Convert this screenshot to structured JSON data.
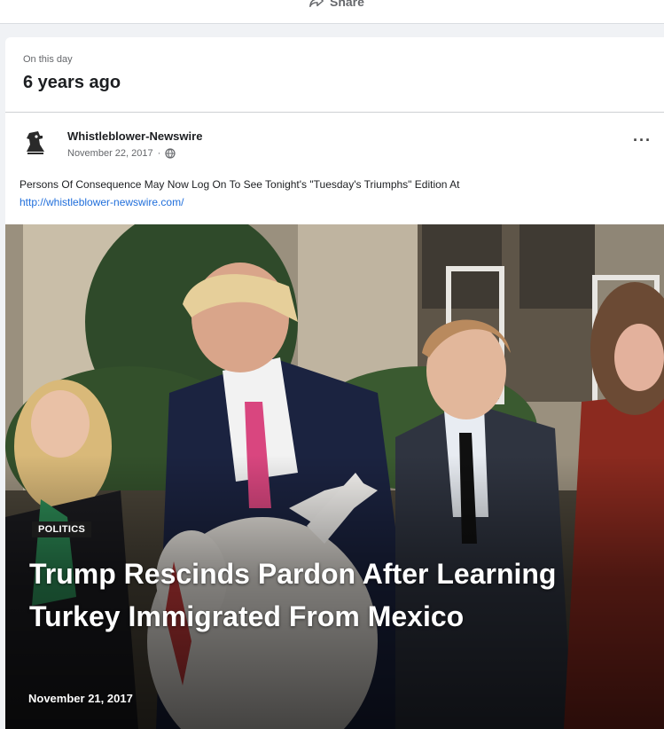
{
  "top_card": {
    "share_label": "Share",
    "share_icon": "share-arrow-icon"
  },
  "memory": {
    "on_this_day": "On this day",
    "years_ago": "6 years ago"
  },
  "post": {
    "page_name": "Whistleblower-Newswire",
    "date": "November 22, 2017",
    "separator": "·",
    "audience_icon": "globe-icon",
    "more_icon": "more-options-icon",
    "more_label": "···",
    "text": "Persons Of Consequence May Now Log On To See Tonight's \"Tuesday's Triumphs\" Edition At",
    "link": "http://whistleblower-newswire.com/"
  },
  "article": {
    "category": "POLITICS",
    "headline": "Trump Rescinds Pardon After Learning Turkey Immigrated From Mexico",
    "date": "November 21, 2017"
  }
}
